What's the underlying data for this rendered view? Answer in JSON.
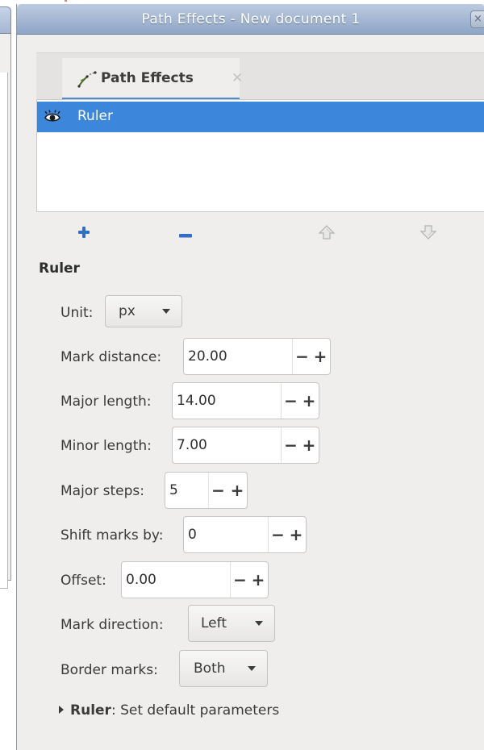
{
  "window": {
    "title": "Path Effects - New document 1",
    "close_glyph": "×"
  },
  "tab": {
    "label": "Path Effects",
    "icon": "path-effects-icon",
    "close_glyph": "✕"
  },
  "effects_list": {
    "items": [
      {
        "label": "Ruler",
        "visible": true,
        "selected": true,
        "icon": "eye-icon"
      }
    ]
  },
  "toolbar": {
    "add": "plus-icon",
    "remove": "minus-icon",
    "move_up": "arrow-up-icon",
    "move_down": "arrow-down-icon"
  },
  "section": {
    "title": "Ruler"
  },
  "params": {
    "unit": {
      "label": "Unit:",
      "value": "px"
    },
    "mark_distance": {
      "label": "Mark distance:",
      "value": "20.00"
    },
    "major_length": {
      "label": "Major length:",
      "value": "14.00"
    },
    "minor_length": {
      "label": "Minor length:",
      "value": "7.00"
    },
    "major_steps": {
      "label": "Major steps:",
      "value": "5"
    },
    "shift_marks_by": {
      "label": "Shift marks by:",
      "value": "0"
    },
    "offset": {
      "label": "Offset:",
      "value": "0.00"
    },
    "mark_direction": {
      "label": "Mark direction:",
      "value": "Left"
    },
    "border_marks": {
      "label": "Border marks:",
      "value": "Both"
    }
  },
  "spin": {
    "minus": "−",
    "plus": "+"
  },
  "expander": {
    "bold": "Ruler",
    "rest": ": Set default parameters"
  },
  "colors": {
    "selection": "#3c87dc",
    "tab_underline": "#4a8ad6",
    "toolbar_blue": "#2f6fc6"
  }
}
